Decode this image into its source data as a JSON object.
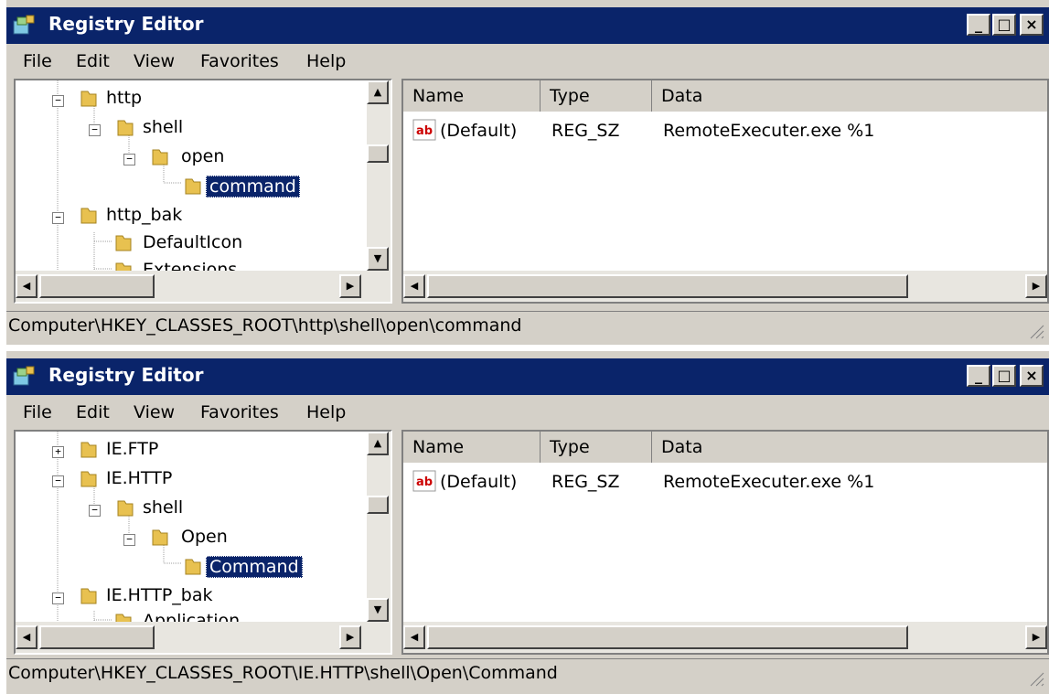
{
  "windows": [
    {
      "title": "Registry Editor",
      "menu": [
        "File",
        "Edit",
        "View",
        "Favorites",
        "Help"
      ],
      "tree": [
        {
          "label": "http",
          "expander": "−"
        },
        {
          "label": "shell",
          "expander": "−"
        },
        {
          "label": "open",
          "expander": "−"
        },
        {
          "label": "command",
          "selected": true
        },
        {
          "label": "http_bak",
          "expander": "−"
        },
        {
          "label": "DefaultIcon"
        },
        {
          "label": "Extensions"
        }
      ],
      "columns": [
        "Name",
        "Type",
        "Data"
      ],
      "values": [
        {
          "name": "(Default)",
          "type": "REG_SZ",
          "data": "RemoteExecuter.exe %1"
        }
      ],
      "status": "Computer\\HKEY_CLASSES_ROOT\\http\\shell\\open\\command"
    },
    {
      "title": "Registry Editor",
      "menu": [
        "File",
        "Edit",
        "View",
        "Favorites",
        "Help"
      ],
      "tree": [
        {
          "label": "IE.FTP",
          "expander": "+"
        },
        {
          "label": "IE.HTTP",
          "expander": "−"
        },
        {
          "label": "shell",
          "expander": "−"
        },
        {
          "label": "Open",
          "expander": "−"
        },
        {
          "label": "Command",
          "selected": true
        },
        {
          "label": "IE.HTTP_bak",
          "expander": "−"
        },
        {
          "label": "Application"
        }
      ],
      "columns": [
        "Name",
        "Type",
        "Data"
      ],
      "values": [
        {
          "name": "(Default)",
          "type": "REG_SZ",
          "data": "RemoteExecuter.exe %1"
        }
      ],
      "status": "Computer\\HKEY_CLASSES_ROOT\\IE.HTTP\\shell\\Open\\Command"
    }
  ],
  "title_buttons": {
    "minimize": "_",
    "maximize": "□",
    "close": "×"
  },
  "icons": {
    "app": "registry-editor-icon",
    "folder": "folder-icon",
    "value": "string-value-icon"
  },
  "colors": {
    "titlebar": "#0a246a",
    "selection": "#0a246a",
    "chrome": "#d4d0c8",
    "folder": "#e8c150"
  }
}
